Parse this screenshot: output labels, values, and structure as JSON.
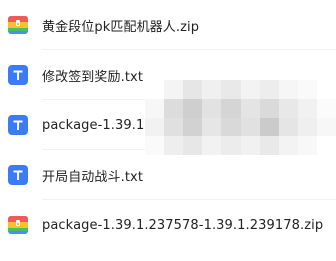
{
  "files": [
    {
      "name": "黄金段位pk匹配机器人.zip",
      "icon": "zip-archive-icon",
      "type": "zip"
    },
    {
      "name": "修改签到奖励.txt",
      "icon": "text-file-icon",
      "type": "txt"
    },
    {
      "name": "package-1.39.1.23",
      "icon": "text-file-icon",
      "type": "txt"
    },
    {
      "name": "开局自动战斗.txt",
      "icon": "text-file-icon",
      "type": "txt"
    },
    {
      "name": "package-1.39.1.237578-1.39.1.239178.zip",
      "icon": "zip-archive-icon",
      "type": "zip"
    }
  ],
  "colors": {
    "txt_icon": "#3b7cf6",
    "zip_red": "#f25b52",
    "zip_yellow": "#f7c02c",
    "zip_green": "#45c06a",
    "zip_blue": "#4a8df7",
    "text": "#222222"
  }
}
